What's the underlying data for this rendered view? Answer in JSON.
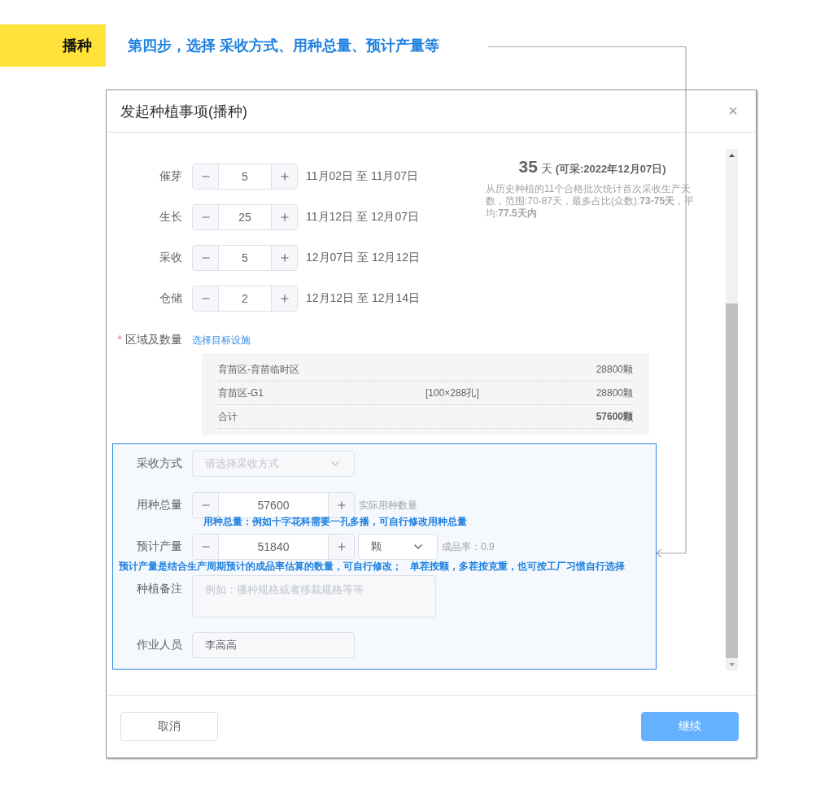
{
  "banner": {
    "tag": "播种",
    "heading": "第四步，选择 采收方式、用种总量、预计产量等"
  },
  "dialog": {
    "title": "发起种植事项(播种)",
    "close": "×"
  },
  "stages": [
    {
      "label": "催芽",
      "value": "5",
      "range": "11月02日 至 11月07日"
    },
    {
      "label": "生长",
      "value": "25",
      "range": "11月12日 至 12月07日"
    },
    {
      "label": "采收",
      "value": "5",
      "range": "12月07日 至 12月12日"
    },
    {
      "label": "仓储",
      "value": "2",
      "range": "12月12日 至 12月14日"
    }
  ],
  "summary": {
    "days": "35",
    "unit": "天",
    "harvest_date": "(可采:2022年12月07日)",
    "note": "从历史种植的11个合格批次统计首次采收生产天数，范围:70-87天，最多占比(众数):**73-75天**，平均:**77.5天内**"
  },
  "area": {
    "required_mark": "*",
    "label": "区域及数量",
    "link": "选择目标设施",
    "rows": [
      {
        "name": "育苗区-育苗临时区",
        "count": "28800颗"
      },
      {
        "name": "育苗区-G1",
        "spec": "[100×288孔]",
        "count": "28800颗"
      }
    ],
    "total": {
      "name": "合计",
      "count": "57600颗"
    }
  },
  "harvest_method": {
    "label": "采收方式",
    "placeholder": "请选择采收方式"
  },
  "seed_total": {
    "label": "用种总量",
    "value": "57600",
    "hint": "实际用种数量",
    "annotation": "用种总量：例如十字花科需要一孔多播，可自行修改用种总量"
  },
  "yield": {
    "label": "预计产量",
    "value": "51840",
    "unit": "颗",
    "rate": "成品率：0.9",
    "annotation": "预计产量是结合生产周期预计的成品率估算的数量，可自行修改；   单茬按颗，多茬按克重，也可按工厂习惯自行选择"
  },
  "remark": {
    "label": "种植备注",
    "placeholder": "例如：播种规格或者移栽规格等等"
  },
  "operator": {
    "label": "作业人员",
    "value": "李高高"
  },
  "buttons": {
    "cancel": "取消",
    "continue": "继续"
  }
}
